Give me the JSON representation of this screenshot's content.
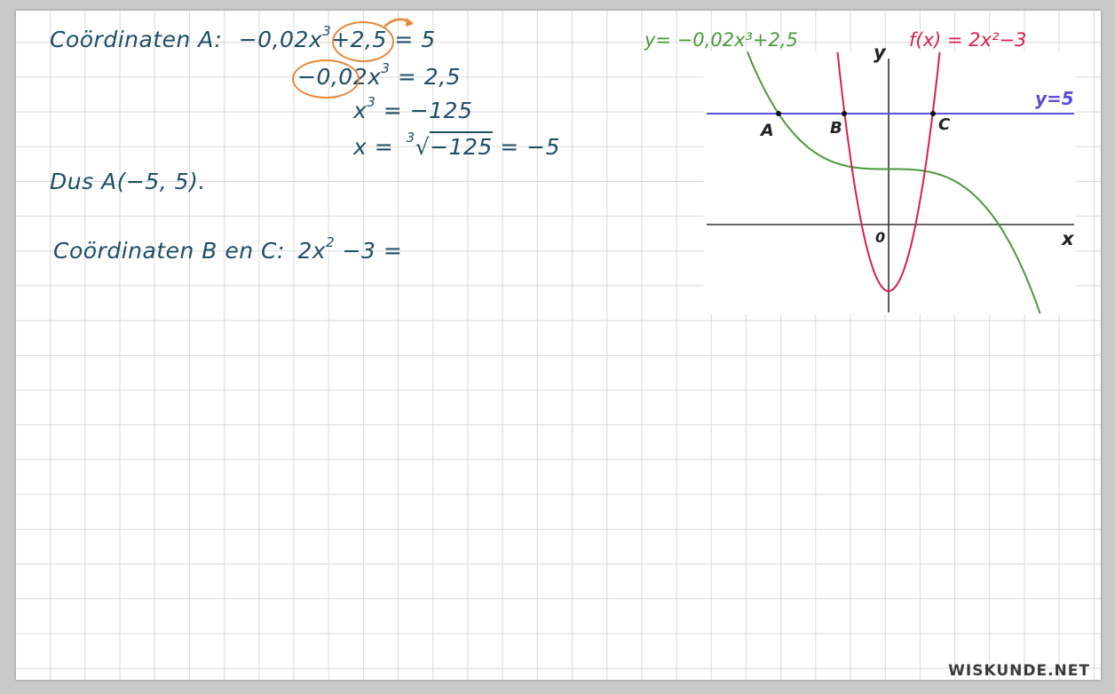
{
  "work": {
    "line1": {
      "label": "Coördinaten A:",
      "lhs_a": "−0,02x",
      "exp3": "3",
      "lhs_b": "+2,5",
      "rhs": "= 5"
    },
    "line2": {
      "lhs": "−0,02x",
      "exp3": "3",
      "rhs": "= 2,5"
    },
    "line3": {
      "lhs": "x",
      "exp3": "3",
      "rhs": "= −125"
    },
    "line4": {
      "lhs": "x =",
      "root_index": "3",
      "radicand": "−125",
      "rhs": "= −5"
    },
    "conclusion": "Dus A(−5, 5).",
    "line5": {
      "label": "Coördinaten B en C:",
      "expr": "2x",
      "exp2": "2",
      "rest": "−3 ="
    }
  },
  "graph": {
    "cubic_label": "y= −0,02x³+2,5",
    "parabola_label": "f(x) = 2x²−3",
    "line_label": "y=5",
    "axis_x": "x",
    "axis_y": "y",
    "origin": "0",
    "point_a": "A",
    "point_b": "B",
    "point_c": "C",
    "colors": {
      "cubic": "#4a9a3a",
      "parabola": "#d81f48",
      "line": "#5a4fd6",
      "ink": "#1e4f66",
      "circle": "#e8873a"
    }
  },
  "brand": "WISKUNDE.NET"
}
